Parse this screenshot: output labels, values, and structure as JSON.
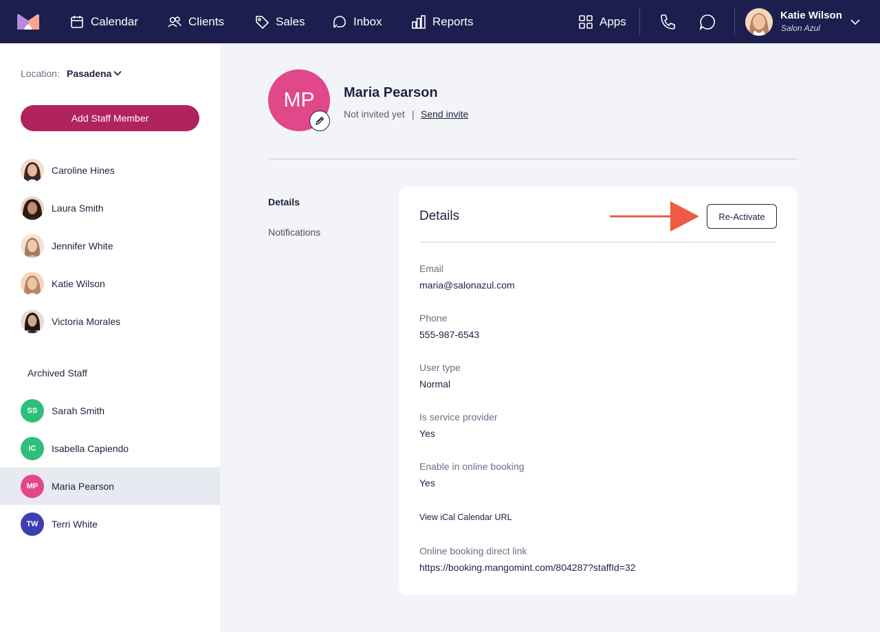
{
  "nav": {
    "items": [
      {
        "label": "Calendar",
        "icon": "calendar-icon"
      },
      {
        "label": "Clients",
        "icon": "clients-icon"
      },
      {
        "label": "Sales",
        "icon": "tag-icon"
      },
      {
        "label": "Inbox",
        "icon": "inbox-icon"
      },
      {
        "label": "Reports",
        "icon": "reports-icon"
      }
    ],
    "apps_label": "Apps",
    "user": {
      "name": "Katie Wilson",
      "business": "Salon Azul"
    }
  },
  "sidebar": {
    "location_label": "Location:",
    "location_value": "Pasadena",
    "add_button": "Add Staff Member",
    "staff": [
      {
        "name": "Caroline Hines"
      },
      {
        "name": "Laura Smith"
      },
      {
        "name": "Jennifer White"
      },
      {
        "name": "Katie Wilson"
      },
      {
        "name": "Victoria Morales"
      }
    ],
    "archived_title": "Archived Staff",
    "archived": [
      {
        "name": "Sarah Smith",
        "initials": "SS",
        "color": "#2ebf7a"
      },
      {
        "name": "Isabella Capiendo",
        "initials": "IC",
        "color": "#2ebf7a"
      },
      {
        "name": "Maria Pearson",
        "initials": "MP",
        "color": "#e2478a",
        "selected": true
      },
      {
        "name": "Terri White",
        "initials": "TW",
        "color": "#3b3fb0"
      }
    ]
  },
  "profile": {
    "initials": "MP",
    "name": "Maria Pearson",
    "status": "Not invited yet",
    "separator": "|",
    "invite_link": "Send invite"
  },
  "tabs": [
    {
      "label": "Details",
      "active": true
    },
    {
      "label": "Notifications",
      "active": false
    }
  ],
  "details": {
    "title": "Details",
    "reactivate_button": "Re-Activate",
    "fields": [
      {
        "label": "Email",
        "value": "maria@salonazul.com"
      },
      {
        "label": "Phone",
        "value": "555-987-6543"
      },
      {
        "label": "User type",
        "value": "Normal"
      },
      {
        "label": "Is service provider",
        "value": "Yes"
      },
      {
        "label": "Enable in online booking",
        "value": "Yes"
      }
    ],
    "ical_link": "View iCal Calendar URL",
    "booking_link_label": "Online booking direct link",
    "booking_link_value": "https://booking.mangomint.com/804287?staffId=32"
  },
  "colors": {
    "topbar": "#1c1e4d",
    "primary_button": "#b0235e",
    "arrow": "#ef5a45"
  }
}
